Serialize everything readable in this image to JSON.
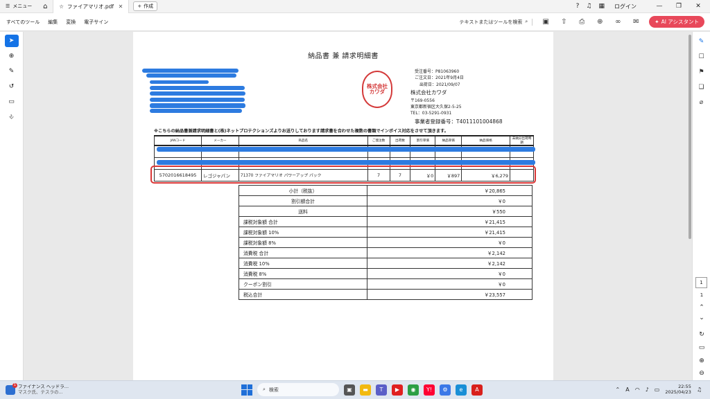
{
  "titlebar": {
    "menu_label": "メニュー",
    "tab_title": "ファイアマリオ.pdf",
    "create_label": "作成",
    "login_label": "ログイン"
  },
  "toolbar": {
    "menus": [
      "すべてのツール",
      "編集",
      "変換",
      "電子サイン"
    ],
    "search_placeholder": "テキストまたはツールを検索",
    "ai_label": "AI アシスタント",
    "ai_color": "#e8485a"
  },
  "document": {
    "title": "納品書 兼 請求明細書",
    "seal_text": "株式会社カワダ",
    "vendor": {
      "order_no": "受注番号：P81063960",
      "order_date": "ご注文日：2021年9月4日",
      "ship_date": "出荷日：2021/09/07",
      "company": "株式会社カワダ",
      "postal": "〒169-0556",
      "address": "東京都新宿区大久保2-5-25",
      "tel": "TEL：03-5291-0931",
      "registration": "事業者登録番号：T4011101004868"
    },
    "notice": "※こちらの納品書兼請求明細書と(株)ネットプロテクションズよりお送りしております請求書を合わせた複数の書類でインボイス対応をさせて頂きます。",
    "columns": [
      "JANコード",
      "メーカー",
      "商品名",
      "ご発注数",
      "出荷数",
      "割引単価",
      "納品単価",
      "納品価格",
      "未納分出荷時期"
    ],
    "item": {
      "jan": "5702016618495",
      "maker": "レゴジャパン",
      "name": "71370 ファイアマリオ パワーアップ パック",
      "ordered": "7",
      "shipped": "7",
      "discount": "￥0",
      "unit_price": "￥897",
      "price": "￥6,279",
      "backorder": ""
    },
    "totals": [
      {
        "label": "小計（税抜）",
        "value": "￥20,865",
        "indent": 0
      },
      {
        "label": "割引額合計",
        "value": "￥0",
        "indent": 0
      },
      {
        "label": "送料",
        "value": "￥550",
        "indent": 0
      },
      {
        "label": "課税対象額 合計",
        "value": "￥21,415",
        "indent": 1
      },
      {
        "label": "課税対象額 10%",
        "value": "￥21,415",
        "indent": 2
      },
      {
        "label": "課税対象額 8%",
        "value": "￥0",
        "indent": 2
      },
      {
        "label": "消費税 合計",
        "value": "￥2,142",
        "indent": 1
      },
      {
        "label": "消費税 10%",
        "value": "￥2,142",
        "indent": 2
      },
      {
        "label": "消費税 8%",
        "value": "￥0",
        "indent": 2
      },
      {
        "label": "クーポン割引",
        "value": "￥0",
        "indent": 1
      },
      {
        "label": "税込合計",
        "value": "￥23,557",
        "indent": 1
      }
    ],
    "highlight_color": "#d93636",
    "redaction_color": "#2d7be0"
  },
  "rightrail": {
    "page_current": "1",
    "page_total": "1"
  },
  "taskbar": {
    "news_title": "ファイナンス ヘッドラ...",
    "news_sub": "マスク氏、テスラの...",
    "news_badge": "1",
    "search_label": "検索",
    "time": "22:55",
    "date": "2025/04/23"
  }
}
